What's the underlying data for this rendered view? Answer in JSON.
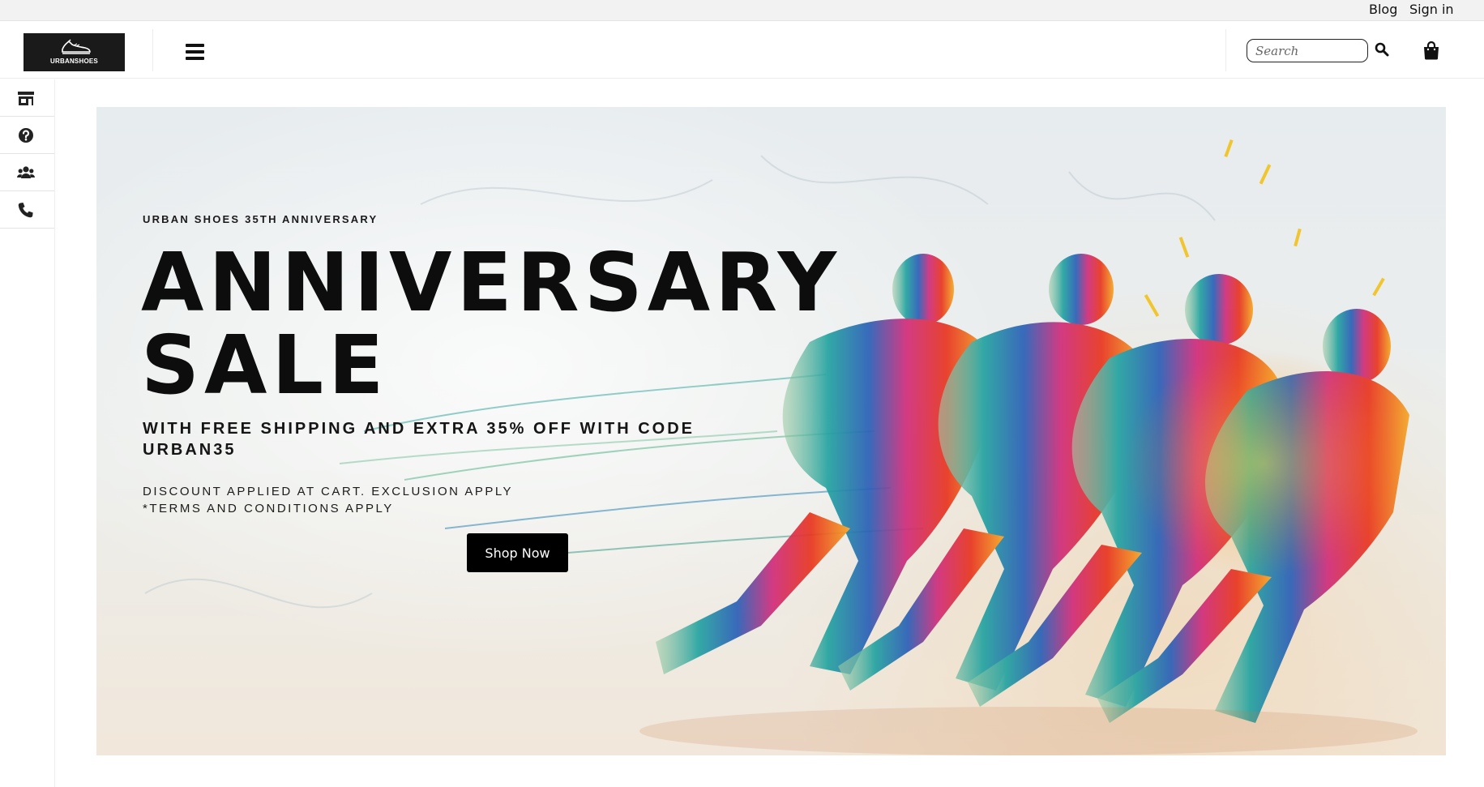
{
  "topbar": {
    "blog_label": "Blog",
    "signin_label": "Sign in"
  },
  "header": {
    "logo_text": "URBANSHOES",
    "search_placeholder": "Search",
    "icons": {
      "menu": "hamburger-menu-icon",
      "search": "search-icon",
      "cart": "shopping-bag-icon"
    }
  },
  "sidebar": {
    "items": [
      {
        "icon": "store-icon"
      },
      {
        "icon": "help-circle-icon"
      },
      {
        "icon": "users-icon"
      },
      {
        "icon": "phone-icon"
      }
    ]
  },
  "hero": {
    "kicker": "URBAN SHOES 35TH ANNIVERSARY",
    "title_line1": "ANNIVERSARY",
    "title_line2": "SALE",
    "subtitle": "WITH FREE SHIPPING AND EXTRA 35% OFF WITH CODE URBAN35",
    "note_line1": "DISCOUNT APPLIED AT CART. EXCLUSION APPLY",
    "note_line2": "*TERMS AND CONDITIONS APPLY",
    "button_label": "Shop Now"
  },
  "colors": {
    "button_bg": "#000000",
    "topbar_bg": "#f2f2f2",
    "logo_bg": "#1a1a1a"
  }
}
